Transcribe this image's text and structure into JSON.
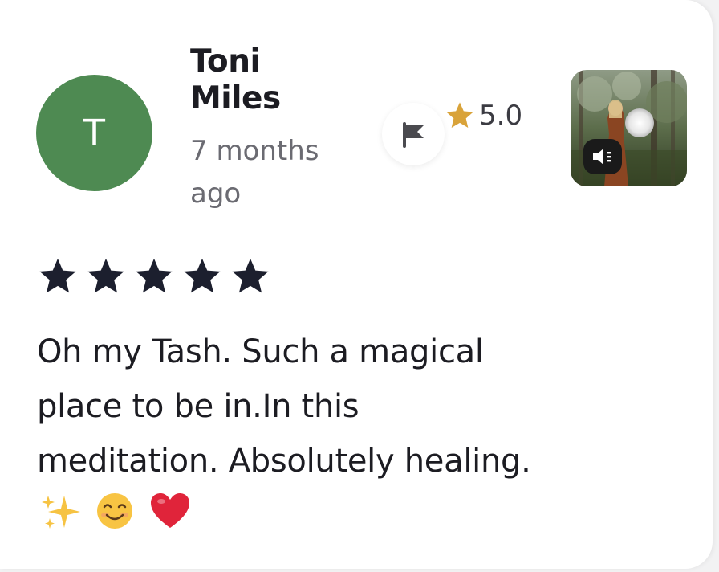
{
  "review": {
    "avatar_initial": "T",
    "reviewer_name": "Toni Miles",
    "time_ago": "7 months ago",
    "rating_value": "5.0",
    "star_count": 5,
    "text": "Oh my Tash. Such a magical place to be in.In this meditation. Absolutely healing.",
    "emojis": [
      "sparkles",
      "smiling-face",
      "red-heart"
    ]
  },
  "colors": {
    "avatar_bg": "#4e8a52",
    "star_gold": "#d9a33a",
    "star_dark": "#1c1f2e",
    "flag_gray": "#4a4a4f"
  },
  "icons": {
    "flag": "flag-icon",
    "rating_star": "star-icon",
    "audio": "speaker-icon"
  }
}
